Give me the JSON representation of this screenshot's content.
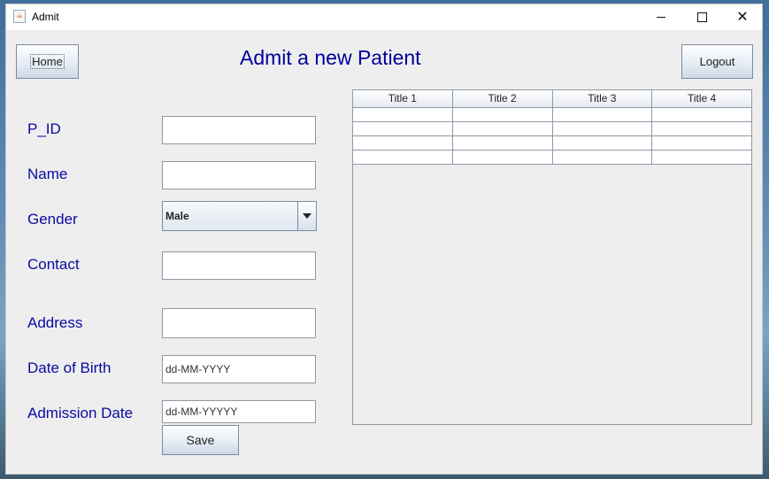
{
  "window": {
    "title": "Admit",
    "app_icon": "java-cup-icon"
  },
  "header": {
    "home_label": "Home",
    "title": "Admit a new Patient",
    "logout_label": "Logout"
  },
  "form": {
    "pid_label": "P_ID",
    "pid_value": "",
    "name_label": "Name",
    "name_value": "",
    "gender_label": "Gender",
    "gender_value": "Male",
    "contact_label": "Contact",
    "contact_value": "",
    "address_label": "Address",
    "address_value": "",
    "dob_label": "Date of Birth",
    "dob_value": "dd-MM-YYYY",
    "admission_label": "Admission Date",
    "admission_value": "dd-MM-YYYYY",
    "save_label": "Save"
  },
  "table": {
    "columns": [
      "Title 1",
      "Title 2",
      "Title 3",
      "Title 4"
    ],
    "rows": [
      [
        "",
        "",
        "",
        ""
      ],
      [
        "",
        "",
        "",
        ""
      ],
      [
        "",
        "",
        "",
        ""
      ],
      [
        "",
        "",
        "",
        ""
      ]
    ]
  }
}
